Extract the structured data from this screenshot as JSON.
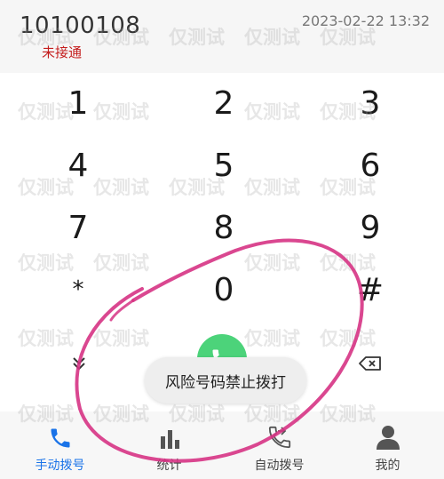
{
  "call_log": {
    "number": "10100108",
    "datetime": "2023-02-22 13:32",
    "status": "未接通",
    "status_color": "#c41e1e"
  },
  "keypad": {
    "keys": [
      "1",
      "2",
      "3",
      "4",
      "5",
      "6",
      "7",
      "8",
      "9",
      "*",
      "0",
      "#"
    ]
  },
  "actions": {
    "collapse_icon": "chevron-double-down-icon",
    "dial_icon": "phone-icon",
    "dial_color": "#4cd37a",
    "backspace_icon": "backspace-icon"
  },
  "toast": {
    "message": "风险号码禁止拨打"
  },
  "tabs": [
    {
      "label": "手动拨号",
      "icon": "phone-icon",
      "active": true
    },
    {
      "label": "统计",
      "icon": "bar-chart-icon",
      "active": false
    },
    {
      "label": "自动拨号",
      "icon": "auto-dial-icon",
      "active": false
    },
    {
      "label": "我的",
      "icon": "person-icon",
      "active": false
    }
  ],
  "theme": {
    "accent": "#1a73e8",
    "annotation_color": "#d63384"
  },
  "watermark": {
    "text": "仅测试"
  }
}
